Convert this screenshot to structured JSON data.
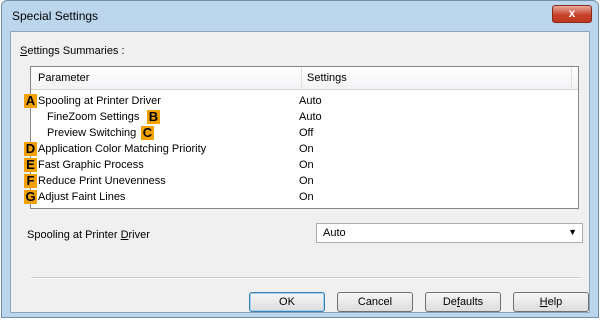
{
  "dialog": {
    "title": "Special Settings",
    "close_label": "x"
  },
  "summaries": {
    "label_prefix": "",
    "label_access": "S",
    "label_rest": "ettings Summaries :",
    "columns": {
      "parameter": "Parameter",
      "settings": "Settings"
    },
    "rows": [
      {
        "marker": "A",
        "name": "Spooling at Printer Driver",
        "value": "Auto"
      },
      {
        "marker": "B",
        "name": "FineZoom Settings",
        "value": "Auto"
      },
      {
        "marker": "C",
        "name": "Preview Switching",
        "value": "Off"
      },
      {
        "marker": "D",
        "name": "Application Color Matching Priority",
        "value": "On"
      },
      {
        "marker": "E",
        "name": "Fast Graphic Process",
        "value": "On"
      },
      {
        "marker": "F",
        "name": "Reduce Print Unevenness",
        "value": "On"
      },
      {
        "marker": "G",
        "name": "Adjust Faint Lines",
        "value": "On"
      }
    ]
  },
  "spooling": {
    "label_prefix": "Spooling at Printer ",
    "label_access": "D",
    "label_rest": "river",
    "selected": "Auto"
  },
  "buttons": {
    "ok": "OK",
    "cancel": "Cancel",
    "defaults_prefix": "De",
    "defaults_access": "f",
    "defaults_rest": "aults",
    "help_access": "H",
    "help_rest": "elp"
  },
  "colors": {
    "marker": "#f5a100",
    "frame": "#bcd6ee",
    "close": "#c8432c"
  }
}
